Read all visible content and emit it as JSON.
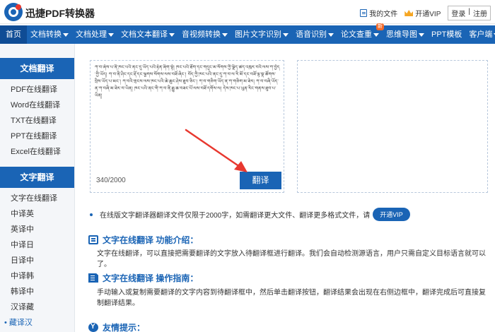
{
  "header": {
    "brand": "迅捷PDF转换器",
    "my_files": "我的文件",
    "open_vip": "开通VIP",
    "login": "登录",
    "register": "注册"
  },
  "nav": {
    "items": [
      {
        "label": "首页",
        "active": true,
        "dropdown": false
      },
      {
        "label": "文档转换",
        "dropdown": true
      },
      {
        "label": "文档处理",
        "dropdown": true
      },
      {
        "label": "文档文本翻译",
        "dropdown": true
      },
      {
        "label": "音视频转换",
        "dropdown": true
      },
      {
        "label": "图片文字识别",
        "dropdown": true
      },
      {
        "label": "语音识别",
        "dropdown": true
      },
      {
        "label": "论文查重",
        "dropdown": true,
        "badge": "新"
      },
      {
        "label": "思维导图",
        "dropdown": true
      },
      {
        "label": "PPT模板",
        "dropdown": false
      },
      {
        "label": "客户端",
        "dropdown": true
      }
    ]
  },
  "sidebar": {
    "doc_heading": "文档翻译",
    "doc_items": [
      "PDF在线翻译",
      "Word在线翻译",
      "TXT在线翻译",
      "PPT在线翻译",
      "Excel在线翻译"
    ],
    "text_heading": "文字翻译",
    "text_items": [
      "文字在线翻译",
      "中译英",
      "英译中",
      "中译日",
      "日译中",
      "中译韩",
      "韩译中",
      "汉译藏",
      "藏译汉"
    ],
    "current": "藏译汉"
  },
  "translator": {
    "input_text": "ཀ་བ་ཞེས་པ་ནི་ཁང་པའི་ནང་དུ་ཡོད་པའི་རྟེན་ཞིག་སྟེ། ཁང་པའི་ཐོག་དང་གདུང་མ་སོགས་ཀྱི་ལྗིད་ཚད་འཁུར་བའི་ལས་ཀ་བྱེད་ཀྱི་ཡོད། ཀ་བ་ནི་ཤིང་དང་རྡོ་དང་ལྕགས་སོགས་ལས་བཟོ་ཞིང་། བོད་ཀྱི་ཁང་པའི་ནང་དུ་ཀ་བ་ལ་རི་མོ་དང་བཟོ་ལྟ་སྣ་ཚོགས་བྲིས་ཡོད་པ་མང་། ཀ་བའི་གྲངས་ལས་ཁང་པའི་ཆེ་ཆུང་ཤེས་ཐུབ་ཅིང་། ཀ་བ་གཅིག་ཡོད་ན་ཀ་གཅིག་མ་ཟེར། ཀ་བ་བཞི་ཡོད་ན་ཀ་བཞི་མ་ཟེར་བ་ཡིན། ཁང་པའི་ནང་གི་ཀ་བ་ནི་རྒྱུ་ཆ་བཟང་པོ་ལས་བཟོ་དགོས་ལ། དེས་ཁང་པ་ཡུན་རིང་གནས་ཐུབ་པ་ཡིན།",
    "counter": "340/2000",
    "translate_button": "翻译"
  },
  "notice": {
    "text": "在线版文字翻译器翻译文件仅限于2000字，如需翻译更大文件、翻译更多格式文件，请",
    "vip_button": "开通VIP"
  },
  "sections": {
    "intro_title": "文字在线翻译 功能介绍：",
    "intro_text": "文字在线翻译，可以直接把需要翻译的文字放入待翻译框进行翻译。我们会自动检测源语言，用户只需自定义目标语言就可以了。",
    "guide_title": "文字在线翻译 操作指南：",
    "guide_text": "手动输入或复制需要翻译的文字内容到待翻译框中，然后单击翻译按钮，翻译结果会出现在右侧边框中，翻译完成后可直接复制翻译结果。",
    "tips_title": "友情提示："
  },
  "colors": {
    "primary": "#1a64b5",
    "nav_active": "#0f4c95",
    "arrow": "#e8382f",
    "badge": "#f26a2a"
  }
}
